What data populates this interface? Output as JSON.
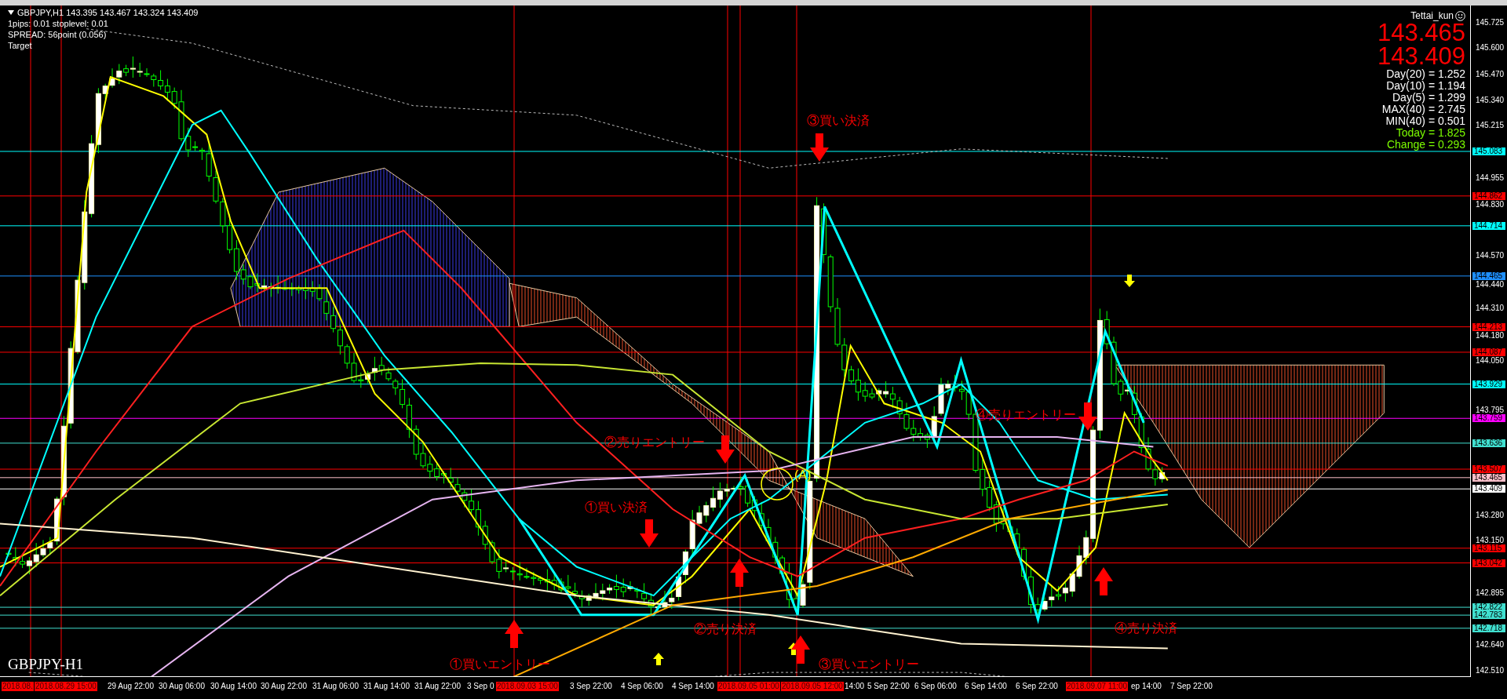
{
  "header": {
    "title": "GBPJPY,H1 143.395 143.467 143.324 143.409",
    "lines": [
      "1pips: 0.01 stoplevel: 0.01",
      "SPREAD: 56point (0.056)",
      "Target"
    ]
  },
  "info_panel": {
    "user": "Tettai_kun",
    "bid": "143.465",
    "ask": "143.409",
    "stats": [
      {
        "text": "Day(20) = 1.252",
        "kind": "plain"
      },
      {
        "text": "Day(10) = 1.194",
        "kind": "plain"
      },
      {
        "text": "Day(5) = 1.299",
        "kind": "plain"
      },
      {
        "text": "MAX(40) = 2.745",
        "kind": "plain"
      },
      {
        "text": "MIN(40) = 0.501",
        "kind": "plain"
      },
      {
        "text": "Today = 1.825",
        "kind": "highlight"
      },
      {
        "text": "Change = 0.293",
        "kind": "highlight"
      }
    ]
  },
  "annotations": [
    {
      "text": "③買い決済",
      "kind": "label"
    },
    {
      "text": "(A)",
      "kind": "marker"
    },
    {
      "text": "②売りエントリー",
      "kind": "label"
    },
    {
      "text": "①買い決済",
      "kind": "label"
    },
    {
      "text": "④売りエントリー",
      "kind": "label"
    },
    {
      "text": "②売り決済",
      "kind": "label"
    },
    {
      "text": "④売り決済",
      "kind": "label"
    },
    {
      "text": "①買いエントリー",
      "kind": "label"
    },
    {
      "text": "③買いエントリー",
      "kind": "label"
    }
  ],
  "arrows": [
    {
      "kind": "down"
    },
    {
      "kind": "down"
    },
    {
      "kind": "down"
    },
    {
      "kind": "down"
    },
    {
      "kind": "up"
    },
    {
      "kind": "up"
    },
    {
      "kind": "up"
    },
    {
      "kind": "up"
    }
  ],
  "chart_label": "GBPJPY-H1",
  "price_axis": {
    "ticks": [
      "145.725",
      "145.600",
      "145.470",
      "145.340",
      "145.215",
      "144.955",
      "144.830",
      "144.570",
      "144.440",
      "144.310",
      "144.180",
      "144.050",
      "143.795",
      "143.280",
      "143.150",
      "142.895",
      "142.640",
      "142.510"
    ],
    "levels": [
      {
        "text": "145.083",
        "color": "#00ffff"
      },
      {
        "text": "144.862",
        "color": "#ff0000"
      },
      {
        "text": "144.714",
        "color": "#00ffff"
      },
      {
        "text": "144.465",
        "color": "#1e90ff"
      },
      {
        "text": "144.213",
        "color": "#ff0000"
      },
      {
        "text": "144.087",
        "color": "#ff0000"
      },
      {
        "text": "143.929",
        "color": "#00ffff"
      },
      {
        "text": "143.759",
        "color": "#ff00ff"
      },
      {
        "text": "143.636",
        "color": "#40e0d0"
      },
      {
        "text": "143.507",
        "color": "#ff0000"
      },
      {
        "text": "143.465",
        "color": "#ffc0cb"
      },
      {
        "text": "143.409",
        "color": "#ffffff"
      },
      {
        "text": "143.115",
        "color": "#ff0000"
      },
      {
        "text": "143.042",
        "color": "#ff0000"
      },
      {
        "text": "142.822",
        "color": "#40e0d0"
      },
      {
        "text": "142.783",
        "color": "#40e0d0"
      },
      {
        "text": "142.718",
        "color": "#40e0d0"
      }
    ]
  },
  "time_axis": [
    {
      "text": "2018.08.",
      "highlighted": true
    },
    {
      "text": "2018.08.29 15:00",
      "highlighted": true
    },
    {
      "text": "29 Aug 22:00",
      "highlighted": false
    },
    {
      "text": "30 Aug 06:00",
      "highlighted": false
    },
    {
      "text": "30 Aug 14:00",
      "highlighted": false
    },
    {
      "text": "30 Aug 22:00",
      "highlighted": false
    },
    {
      "text": "31 Aug 06:00",
      "highlighted": false
    },
    {
      "text": "31 Aug 14:00",
      "highlighted": false
    },
    {
      "text": "31 Aug 22:00",
      "highlighted": false
    },
    {
      "text": "3 Sep 0",
      "highlighted": false
    },
    {
      "text": "2018.09.03 15:00",
      "highlighted": true
    },
    {
      "text": "3 Sep 22:00",
      "highlighted": false
    },
    {
      "text": "4 Sep 06:00",
      "highlighted": false
    },
    {
      "text": "4 Sep 14:00",
      "highlighted": false
    },
    {
      "text": "2018.09.05 01:00",
      "highlighted": true
    },
    {
      "text": "2018.09.05 12:00",
      "highlighted": true
    },
    {
      "text": "14:00",
      "highlighted": false
    },
    {
      "text": "5 Sep 22:00",
      "highlighted": false
    },
    {
      "text": "6 Sep 06:00",
      "highlighted": false
    },
    {
      "text": "6 Sep 14:00",
      "highlighted": false
    },
    {
      "text": "6 Sep 22:00",
      "highlighted": false
    },
    {
      "text": "2018.09.07 11:00",
      "highlighted": true
    },
    {
      "text": "ep 14:00",
      "highlighted": false
    },
    {
      "text": "7 Sep 22:00",
      "highlighted": false
    }
  ]
}
